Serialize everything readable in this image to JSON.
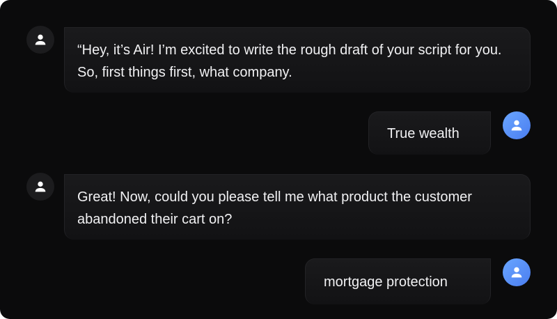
{
  "conversation": {
    "messages": [
      {
        "role": "assistant",
        "icon": "person-icon",
        "text": "“Hey, it’s Air! I’m excited to write the rough draft of your script for you. So, first things first, what company."
      },
      {
        "role": "user",
        "icon": "person-icon",
        "text": "True wealth"
      },
      {
        "role": "assistant",
        "icon": "person-icon",
        "text": "Great! Now, could you please tell me what product the customer abandoned their cart on?"
      },
      {
        "role": "user",
        "icon": "person-icon",
        "text": "mortgage protection"
      }
    ]
  },
  "colors": {
    "background": "#0b0b0c",
    "bubble": "#1a1a1c",
    "user_avatar": "#5a8ef5",
    "text": "#f1f1f3"
  }
}
